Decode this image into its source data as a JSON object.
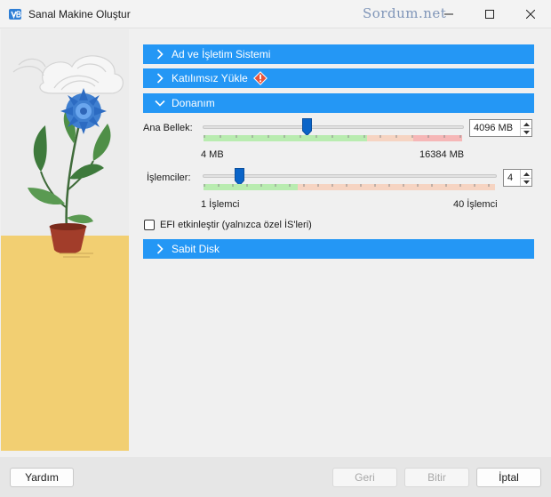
{
  "window": {
    "title": "Sanal Makine Oluştur",
    "watermark": "Sordum.net"
  },
  "sections": [
    {
      "label": "Ad ve İşletim Sistemi",
      "expanded": false
    },
    {
      "label": "Katılımsız Yükle",
      "expanded": false,
      "warning": true
    },
    {
      "label": "Donanım",
      "expanded": true
    },
    {
      "label": "Sabit Disk",
      "expanded": false
    }
  ],
  "hardware": {
    "memory": {
      "label": "Ana Bellek:",
      "value": "4096 MB",
      "min_label": "4 MB",
      "max_label": "16384 MB",
      "fraction": 0.4
    },
    "processors": {
      "label": "İşlemciler:",
      "value": "4",
      "min_label": "1 İşlemci",
      "max_label": "40 İşlemci",
      "fraction": 0.1
    },
    "efi": {
      "label": "EFI etkinleştir (yalnızca özel İS'leri)",
      "checked": false
    }
  },
  "buttons": {
    "help": "Yardım",
    "back": "Geri",
    "finish": "Bitir",
    "cancel": "İptal"
  },
  "colors": {
    "accent": "#2497f5",
    "slider_thumb": "#0a64c8",
    "scale_green": "#b9ecb0",
    "scale_orange": "#f6d4c2",
    "scale_red": "#f6b7b7"
  },
  "icons": {
    "app": "virtualbox-icon",
    "warning": "warning-icon",
    "collapsed": "chevron-right-icon",
    "expanded": "chevron-down-icon"
  }
}
